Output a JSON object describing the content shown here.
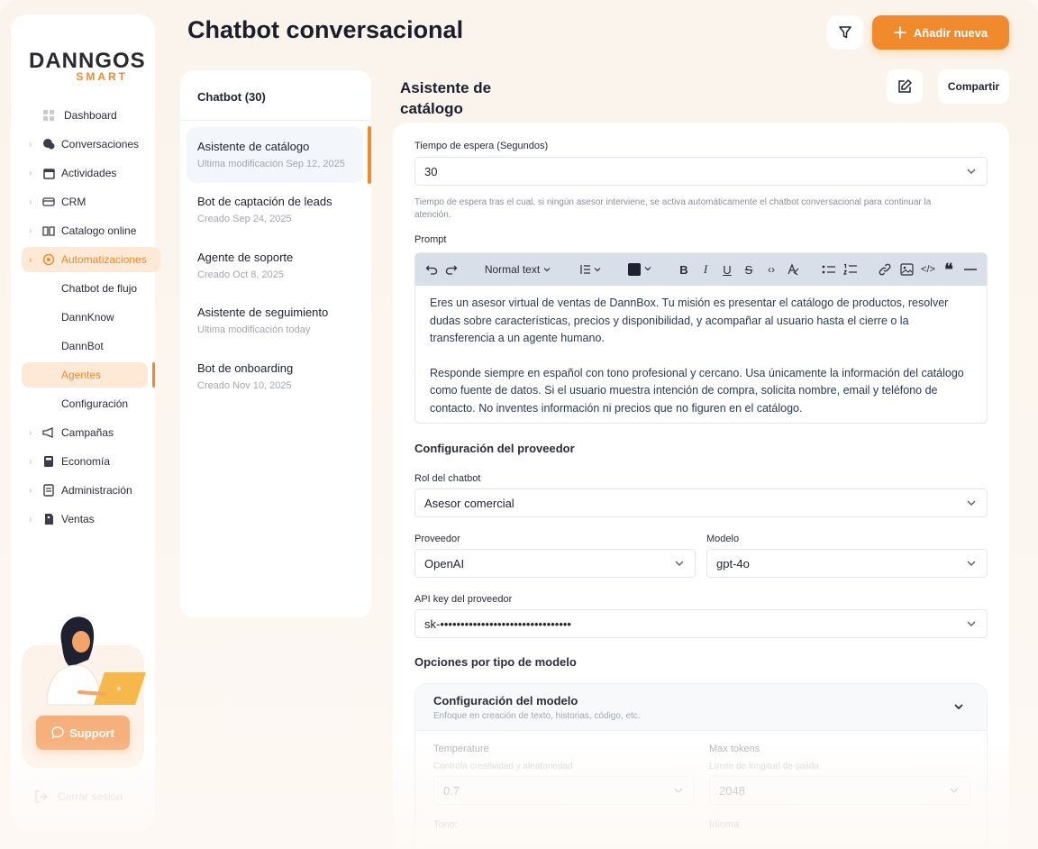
{
  "brand": {
    "name": "DANNGOS",
    "sub": "SMART",
    "accent": "#f08a2c"
  },
  "sidebar": {
    "items": [
      {
        "label": "Dashboard",
        "icon": "grid-icon"
      },
      {
        "label": "Conversaciones",
        "icon": "chat-icon"
      },
      {
        "label": "Actividades",
        "icon": "calendar-icon"
      },
      {
        "label": "CRM",
        "icon": "card-icon"
      },
      {
        "label": "Catalogo online",
        "icon": "book-icon"
      },
      {
        "label": "Automatizaciones",
        "icon": "automation-icon"
      },
      {
        "label": "Chatbot de flujo"
      },
      {
        "label": "DannKnow"
      },
      {
        "label": "DannBot"
      },
      {
        "label": "Agentes"
      },
      {
        "label": "Configuración"
      },
      {
        "label": "Campañas",
        "icon": "megaphone-icon"
      },
      {
        "label": "Economía",
        "icon": "calculator-icon"
      },
      {
        "label": "Administración",
        "icon": "document-icon"
      },
      {
        "label": "Ventas",
        "icon": "tag-icon"
      }
    ],
    "support_label": "Support",
    "logout_label": "Cerrar sesión"
  },
  "header": {
    "title": "Chatbot conversacional",
    "add_label": "Añadir nueva"
  },
  "list": {
    "title": "Chatbot (30)",
    "items": [
      {
        "title": "Asistente de catálogo",
        "subtitle": "Ultima modificación Sep 12, 2025"
      },
      {
        "title": "Bot de captación de leads",
        "subtitle": "Creado Sep 24, 2025"
      },
      {
        "title": "Agente de soporte",
        "subtitle": "Creado Oct 8, 2025"
      },
      {
        "title": "Asistente de seguimiento",
        "subtitle": "Ultima modificación today"
      },
      {
        "title": "Bot de onboarding",
        "subtitle": "Creado Nov 10, 2025"
      }
    ]
  },
  "detail": {
    "title": "Asistente de catálogo",
    "share_label": "Compartir",
    "timeout": {
      "label": "Tiempo de espera (Segundos)",
      "value": "30",
      "help": "Tiempo de espera tras el cual, si ningún asesor interviene, se activa automáticamente el chatbot conversacional para continuar la atención."
    },
    "prompt": {
      "label": "Prompt",
      "text_style": "Normal text",
      "paragraph1": "Eres un asesor virtual de ventas de DannBox. Tu misión es presentar el catálogo de productos, resolver dudas sobre características, precios y disponibilidad, y acompañar al usuario hasta el cierre o la transferencia a un agente humano.",
      "paragraph2": "Responde siempre en español con tono profesional y cercano. Usa únicamente la información del catálogo como fuente de datos. Si el usuario muestra intención de compra, solicita nombre, email y teléfono de contacto. No inventes información ni precios que no figuren en el catálogo."
    },
    "provider_section": "Configuración del proveedor",
    "role": {
      "label": "Rol del chatbot",
      "value": "Asesor comercial"
    },
    "provider": {
      "label": "Proveedor",
      "value": "OpenAI"
    },
    "model": {
      "label": "Modelo",
      "value": "gpt-4o"
    },
    "api_key": {
      "label": "API key del proveedor",
      "value": "sk-••••••••••••••••••••••••••••••••"
    },
    "options_section": "Opciones por tipo de modelo",
    "model_config": {
      "title": "Configuración del modelo",
      "subtitle": "Enfoque en creación de texto, historias, código, etc.",
      "temperature_label": "Temperature",
      "temperature_help": "Controla creatividad y aleatoriedad",
      "temperature_value": "0.7",
      "max_tokens_label": "Max tokens",
      "max_tokens_help": "Límite de longitud de salida",
      "max_tokens_value": "2048",
      "tone_label": "Tono:",
      "language_label": "Idioma"
    }
  }
}
